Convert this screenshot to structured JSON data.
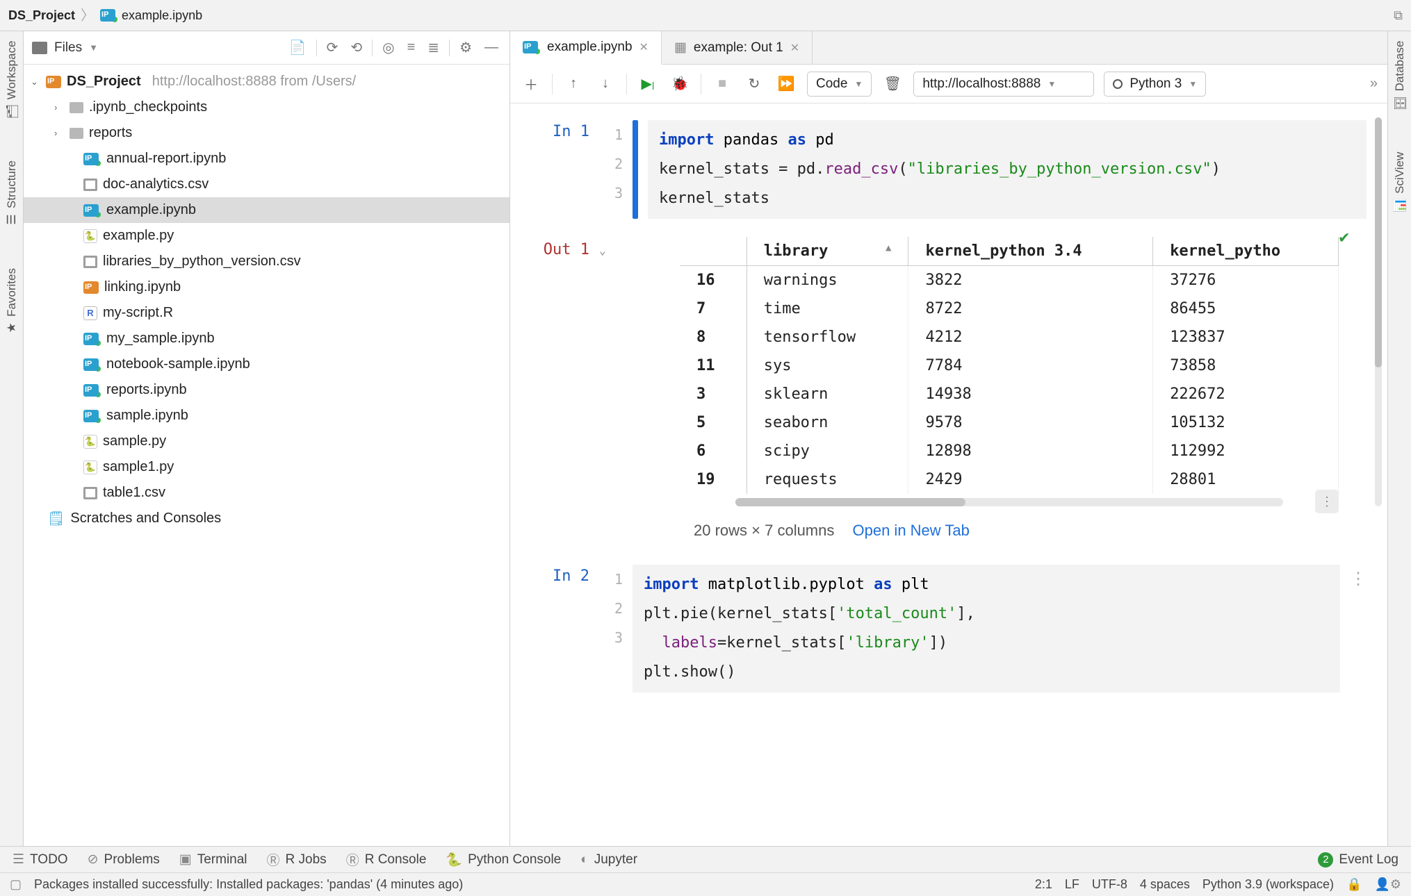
{
  "breadcrumb": {
    "project": "DS_Project",
    "file": "example.ipynb"
  },
  "project_toolbar": {
    "view": "Files"
  },
  "tree": {
    "root": {
      "name": "DS_Project",
      "url": "http://localhost:8888 from /Users/"
    },
    "children": [
      {
        "kind": "folder",
        "name": ".ipynb_checkpoints"
      },
      {
        "kind": "folder",
        "name": "reports"
      },
      {
        "kind": "ipynb",
        "name": "annual-report.ipynb"
      },
      {
        "kind": "csv",
        "name": "doc-analytics.csv"
      },
      {
        "kind": "ipynb",
        "name": "example.ipynb",
        "selected": true
      },
      {
        "kind": "py",
        "name": "example.py"
      },
      {
        "kind": "csv",
        "name": "libraries_by_python_version.csv"
      },
      {
        "kind": "ipynb-orange",
        "name": "linking.ipynb"
      },
      {
        "kind": "r",
        "name": "my-script.R"
      },
      {
        "kind": "ipynb",
        "name": "my_sample.ipynb"
      },
      {
        "kind": "ipynb",
        "name": "notebook-sample.ipynb"
      },
      {
        "kind": "ipynb",
        "name": "reports.ipynb"
      },
      {
        "kind": "ipynb",
        "name": "sample.ipynb"
      },
      {
        "kind": "py",
        "name": "sample.py"
      },
      {
        "kind": "py",
        "name": "sample1.py"
      },
      {
        "kind": "csv",
        "name": "table1.csv"
      }
    ],
    "scratches": "Scratches and Consoles"
  },
  "left_rail": {
    "workspace": "Workspace",
    "structure": "Structure",
    "favorites": "Favorites"
  },
  "right_rail": {
    "database": "Database",
    "sciview": "SciView"
  },
  "editor_tabs": [
    {
      "label": "example.ipynb",
      "kind": "ipynb",
      "active": true
    },
    {
      "label": "example: Out 1",
      "kind": "grid",
      "active": false
    }
  ],
  "nb_toolbar": {
    "cell_type": "Code",
    "server_url": "http://localhost:8888",
    "kernel": "Python 3"
  },
  "cells": {
    "in1": {
      "prompt": "In 1",
      "lines": [
        "1",
        "2",
        "3"
      ],
      "code": {
        "l1_kw": "import",
        "l1_mod": "pandas",
        "l1_as": "as",
        "l1_al": "pd",
        "l2": "kernel_stats = pd.read_csv(",
        "l2_fn": "read_csv",
        "l2_str": "\"libraries_by_python_version.csv\"",
        "l2_end": ")",
        "l3": "kernel_stats"
      }
    },
    "out1": {
      "prompt": "Out 1",
      "dims": "20 rows × 7 columns",
      "open_link": "Open in New Tab"
    },
    "in2": {
      "prompt": "In 2",
      "lines": [
        "1",
        "2",
        "",
        "3"
      ],
      "code": {
        "l1_kw": "import",
        "l1_mod": "matplotlib.pyplot",
        "l1_as": "as",
        "l1_al": "plt",
        "l2a": "plt.pie(kernel_stats[",
        "l2s1": "'total_count'",
        "l2b": "],",
        "l2c": "  labels",
        "l2eq": "=",
        "l2d": "kernel_stats[",
        "l2s2": "'library'",
        "l2e": "])",
        "l3": "plt.show()"
      }
    }
  },
  "chart_data": {
    "type": "table",
    "title": "kernel_stats (head, sorted by library desc)",
    "columns": [
      "",
      "library",
      "kernel_python 3.4",
      "kernel_pytho"
    ],
    "rows": [
      [
        "16",
        "warnings",
        "3822",
        "37276"
      ],
      [
        "7",
        "time",
        "8722",
        "86455"
      ],
      [
        "8",
        "tensorflow",
        "4212",
        "123837"
      ],
      [
        "11",
        "sys",
        "7784",
        "73858"
      ],
      [
        "3",
        "sklearn",
        "14938",
        "222672"
      ],
      [
        "5",
        "seaborn",
        "9578",
        "105132"
      ],
      [
        "6",
        "scipy",
        "12898",
        "112992"
      ],
      [
        "19",
        "requests",
        "2429",
        "28801"
      ]
    ],
    "sort": {
      "column": "library",
      "direction": "asc_icon_shown_triangle_up"
    },
    "shape_note": "20 rows × 7 columns"
  },
  "tool_windows": {
    "todo": "TODO",
    "problems": "Problems",
    "terminal": "Terminal",
    "rjobs": "R Jobs",
    "rconsole": "R Console",
    "pyconsole": "Python Console",
    "jupyter": "Jupyter",
    "event_log": "Event Log",
    "event_badge": "2"
  },
  "status_bar": {
    "msg": "Packages installed successfully: Installed packages: 'pandas' (4 minutes ago)",
    "pos": "2:1",
    "eol": "LF",
    "enc": "UTF-8",
    "indent": "4 spaces",
    "interp": "Python 3.9 (workspace)"
  }
}
